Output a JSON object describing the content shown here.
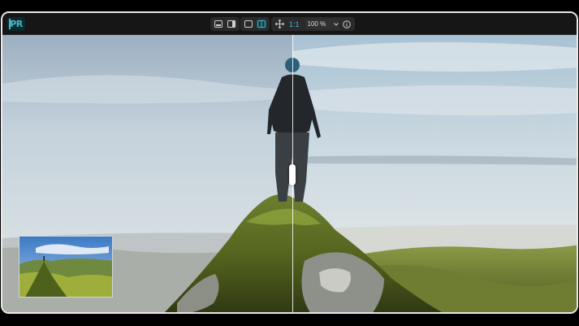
{
  "app": {
    "logo_text": "PR"
  },
  "toolbar": {
    "view_buttons": [
      {
        "icon": "single-view-icon"
      },
      {
        "icon": "side-panel-icon"
      }
    ],
    "compare_buttons": [
      {
        "icon": "frame-view-icon",
        "active": false
      },
      {
        "icon": "split-compare-icon",
        "active": true
      }
    ],
    "pan_icon": "move-icon",
    "zoom_ratio": "1:1",
    "zoom_value": "100 %",
    "zoom_dropdown_icon": "chevron-down-icon",
    "info_icon": "info-icon"
  },
  "viewer": {
    "mode": "split-before-after",
    "split_position": 0.5,
    "accent": "#49b9c9"
  }
}
